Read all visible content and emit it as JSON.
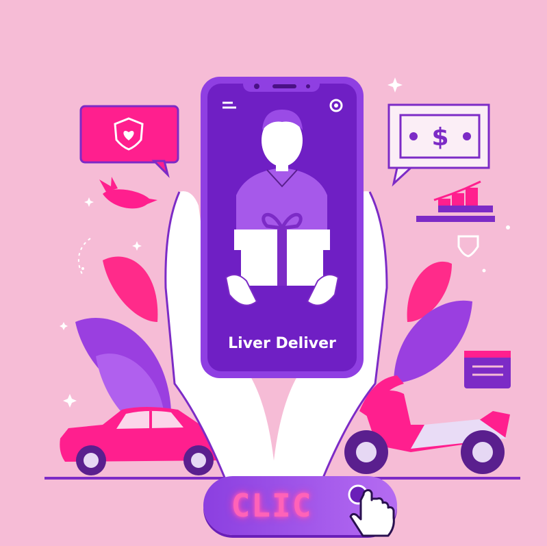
{
  "app": {
    "title": "Liver Deliver"
  },
  "button": {
    "label": "CLIC"
  },
  "icons": [
    "menu-icon",
    "record-icon",
    "heart-shield-icon",
    "dollar-icon",
    "growth-chart-icon",
    "shield-icon",
    "bird-icon",
    "gift-icon",
    "pointer-hand-icon"
  ],
  "colors": {
    "background": "#f6bcd6",
    "accent": "#7a22c8",
    "pink": "#ff1f8e",
    "button_text": "#ff63b8"
  }
}
